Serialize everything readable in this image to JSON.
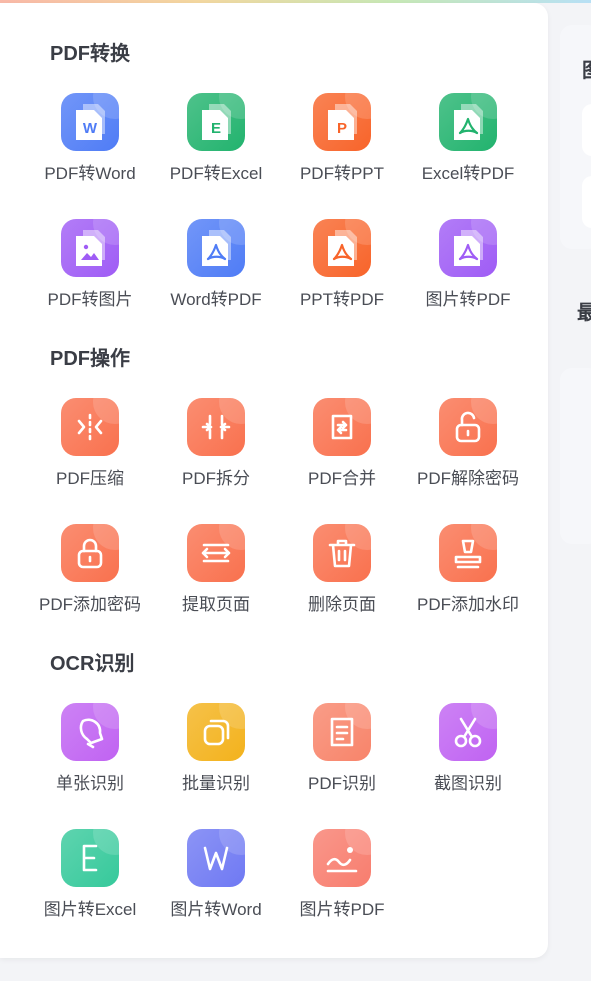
{
  "sections": [
    {
      "title": "PDF转换",
      "tools": [
        {
          "label": "PDF转Word",
          "icon": "pdf-to-word-icon",
          "color": "#4f7cf6"
        },
        {
          "label": "PDF转Excel",
          "icon": "pdf-to-excel-icon",
          "color": "#22b36e"
        },
        {
          "label": "PDF转PPT",
          "icon": "pdf-to-ppt-icon",
          "color": "#f8642a"
        },
        {
          "label": "Excel转PDF",
          "icon": "excel-to-pdf-icon",
          "color": "#22b36e"
        },
        {
          "label": "PDF转图片",
          "icon": "pdf-to-image-icon",
          "color": "#9f5cf5"
        },
        {
          "label": "Word转PDF",
          "icon": "word-to-pdf-icon",
          "color": "#4f7cf6"
        },
        {
          "label": "PPT转PDF",
          "icon": "ppt-to-pdf-icon",
          "color": "#f8642a"
        },
        {
          "label": "图片转PDF",
          "icon": "image-to-pdf-icon",
          "color": "#9f5cf5"
        }
      ]
    },
    {
      "title": "PDF操作",
      "tools": [
        {
          "label": "PDF压缩",
          "icon": "compress-icon",
          "color": "#f9714e"
        },
        {
          "label": "PDF拆分",
          "icon": "split-icon",
          "color": "#f9714e"
        },
        {
          "label": "PDF合并",
          "icon": "merge-icon",
          "color": "#f9714e"
        },
        {
          "label": "PDF解除密码",
          "icon": "unlock-icon",
          "color": "#f9714e"
        },
        {
          "label": "PDF添加密码",
          "icon": "lock-icon",
          "color": "#f9714e"
        },
        {
          "label": "提取页面",
          "icon": "extract-pages-icon",
          "color": "#f9714e"
        },
        {
          "label": "删除页面",
          "icon": "delete-pages-icon",
          "color": "#f9714e"
        },
        {
          "label": "PDF添加水印",
          "icon": "watermark-stamp-icon",
          "color": "#f9714e"
        }
      ]
    },
    {
      "title": "OCR识别",
      "tools": [
        {
          "label": "单张识别",
          "icon": "bell-icon",
          "color": "#c063f2"
        },
        {
          "label": "批量识别",
          "icon": "batch-icon",
          "color": "#f3b21c"
        },
        {
          "label": "PDF识别",
          "icon": "document-lines-icon",
          "color": "#f8846a"
        },
        {
          "label": "截图识别",
          "icon": "scissors-icon",
          "color": "#c063f2"
        },
        {
          "label": "图片转Excel",
          "icon": "excel-e-icon",
          "color": "#36c99b"
        },
        {
          "label": "图片转Word",
          "icon": "word-w-icon",
          "color": "#6f79f3"
        },
        {
          "label": "图片转PDF",
          "icon": "image-wave-icon",
          "color": "#f87d6e"
        }
      ]
    }
  ],
  "sidebar": {
    "title_1": "图",
    "title_2": "最"
  }
}
